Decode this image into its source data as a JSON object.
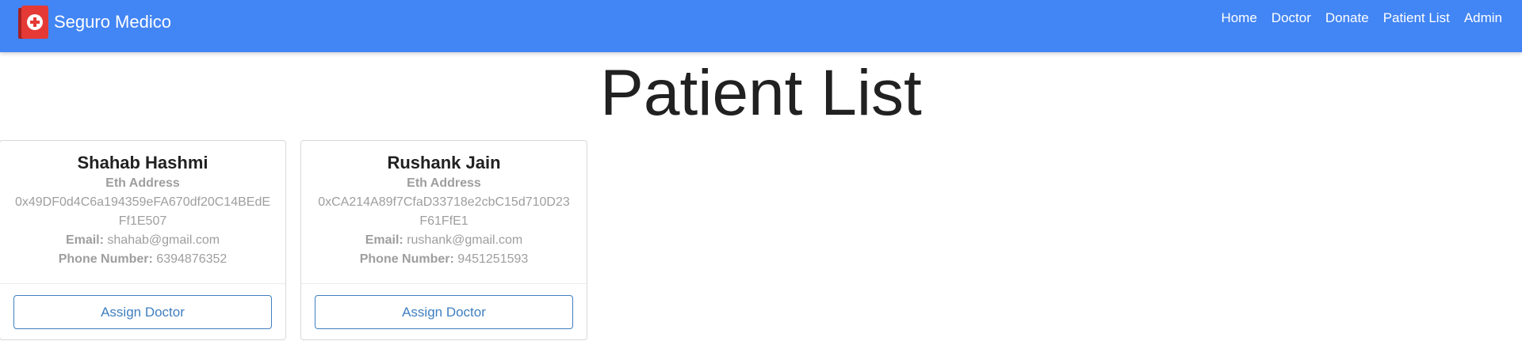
{
  "navbar": {
    "brand": "Seguro Medico",
    "logo_icon": "medical-book-icon",
    "links": [
      "Home",
      "Doctor",
      "Donate",
      "Patient List",
      "Admin"
    ],
    "color": "#4285f4"
  },
  "page": {
    "title": "Patient List"
  },
  "patients": [
    {
      "name": "Shahab Hashmi",
      "eth_label": "Eth Address",
      "eth_address": "0x49DF0d4C6a194359eFA670df20C14BEdEFf1E507",
      "email_label": "Email:",
      "email": "shahab@gmail.com",
      "phone_label": "Phone Number:",
      "phone": "6394876352",
      "button": "Assign Doctor"
    },
    {
      "name": "Rushank Jain",
      "eth_label": "Eth Address",
      "eth_address": "0xCA214A89f7CfaD33718e2cbC15d710D23F61FfE1",
      "email_label": "Email:",
      "email": "rushank@gmail.com",
      "phone_label": "Phone Number:",
      "phone": "9451251593",
      "button": "Assign Doctor"
    }
  ]
}
